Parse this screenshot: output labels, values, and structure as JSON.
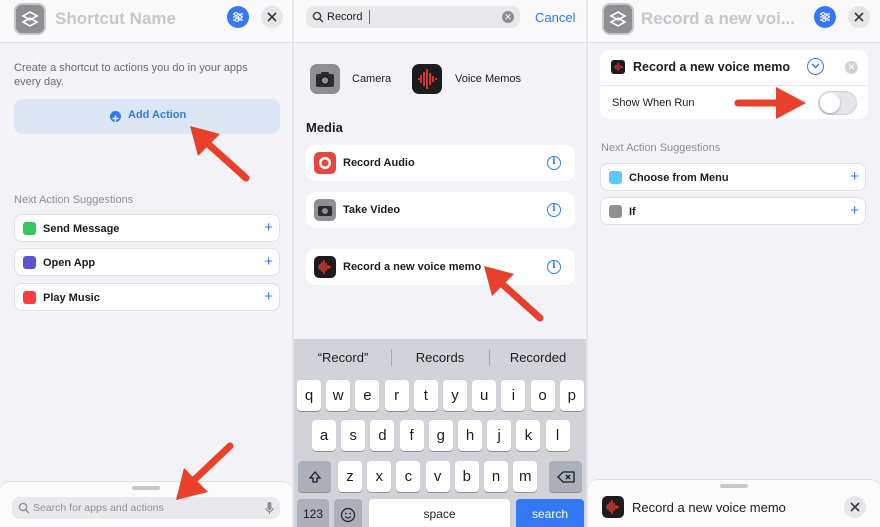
{
  "colors": {
    "accent": "#3478f6",
    "arrow": "#e8402a"
  },
  "panel1": {
    "title_placeholder": "Shortcut Name",
    "hint": "Create a shortcut to actions you do in your apps every day.",
    "add_action": "Add Action",
    "suggestions_label": "Next Action Suggestions",
    "suggestions": [
      {
        "label": "Send Message",
        "icon": "messages-icon",
        "color": "#34c759"
      },
      {
        "label": "Open App",
        "icon": "open-app-icon",
        "color": "#5856d6"
      },
      {
        "label": "Play Music",
        "icon": "music-icon",
        "color": "#fc3c44"
      }
    ],
    "search_placeholder": "Search for apps and actions"
  },
  "panel2": {
    "search_value": "Record",
    "cancel": "Cancel",
    "apps": [
      {
        "label": "Camera",
        "icon": "camera-app-icon"
      },
      {
        "label": "Voice Memos",
        "icon": "voice-memos-app-icon"
      }
    ],
    "media_header": "Media",
    "results": [
      {
        "label": "Record Audio",
        "icon": "record-audio-icon"
      },
      {
        "label": "Take Video",
        "icon": "take-video-icon"
      },
      {
        "label": "Record a new voice memo",
        "icon": "voice-memo-icon"
      }
    ],
    "predictions": [
      "“Record”",
      "Records",
      "Recorded"
    ],
    "keyboard": {
      "row1": [
        "q",
        "w",
        "e",
        "r",
        "t",
        "y",
        "u",
        "i",
        "o",
        "p"
      ],
      "row2": [
        "a",
        "s",
        "d",
        "f",
        "g",
        "h",
        "j",
        "k",
        "l"
      ],
      "row3": [
        "z",
        "x",
        "c",
        "v",
        "b",
        "n",
        "m"
      ],
      "num_key": "123",
      "space_key": "space",
      "go_key": "search"
    }
  },
  "panel3": {
    "title_placeholder": "Record a new voi...",
    "action_title": "Record a new voice memo",
    "show_when_run": "Show When Run",
    "show_when_run_on": false,
    "suggestions_label": "Next Action Suggestions",
    "suggestions": [
      {
        "label": "Choose from Menu",
        "icon": "choose-menu-icon",
        "color": "#5ac8fa"
      },
      {
        "label": "If",
        "icon": "if-icon",
        "color": "#8e8e93"
      }
    ],
    "sheet_title": "Record a new voice memo"
  }
}
